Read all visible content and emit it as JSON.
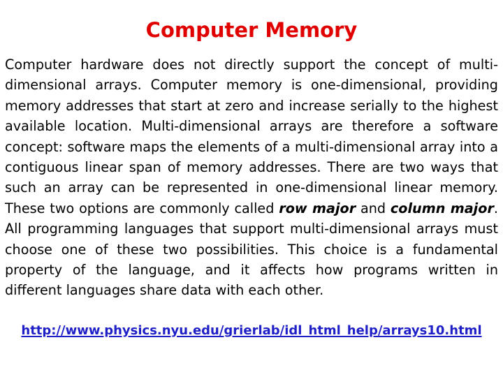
{
  "slide": {
    "title": "Computer Memory",
    "title_color": "#e00000",
    "background_color": "#ffffff",
    "body": {
      "part1": "Computer hardware does not directly support the concept of multi-dimensional arrays. Computer memory is one-dimensional, providing memory addresses that start at zero and increase serially to the highest available location. Multi-dimensional arrays are therefore a software concept: software maps the elements of a multi-dimensional array into a contiguous linear span of memory addresses. There are two ways that such an array can be represented in one-dimensional linear memory. These two options are commonly called ",
      "emphasis1": "row major",
      "part2": " and ",
      "emphasis2": "column major",
      "part3": ". All programming languages that support multi-dimensional arrays must choose one of these two possibilities. This choice is a fundamental property of the language, and it affects how programs written in different languages share data with each other."
    },
    "source_link": {
      "text": "http://www.physics.nyu.edu/grierlab/idl_html_help/arrays10.html",
      "color": "#1f1fc8"
    }
  }
}
